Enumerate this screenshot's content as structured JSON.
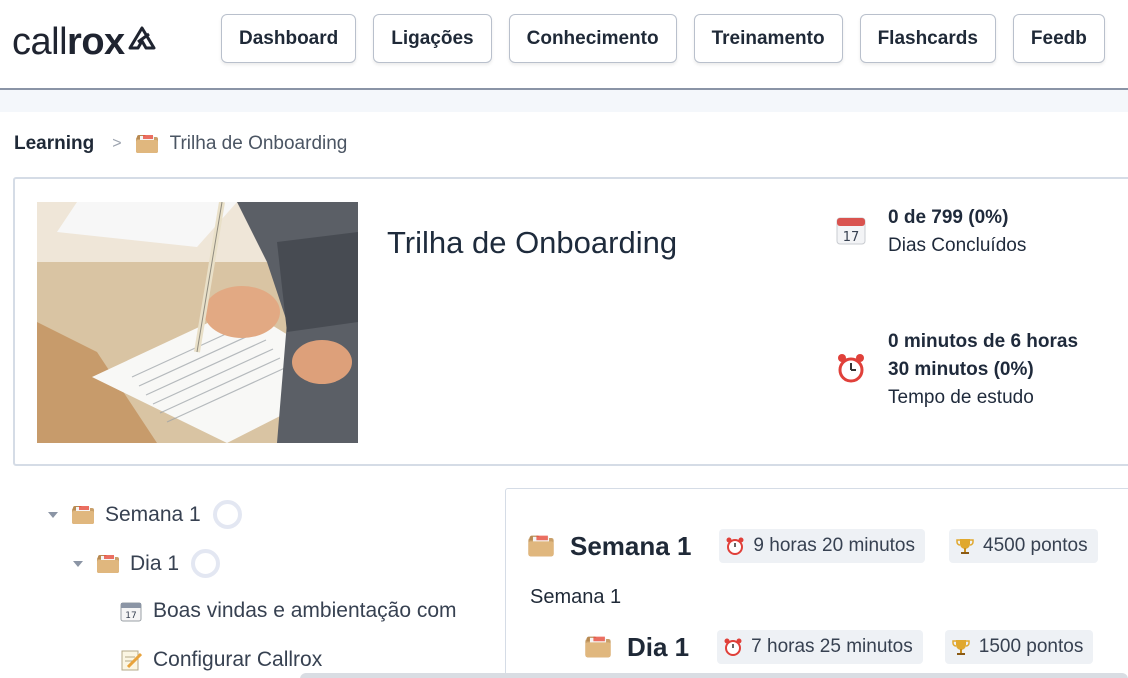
{
  "brand": {
    "name_thin": "call",
    "name_bold": "rox"
  },
  "nav": [
    "Dashboard",
    "Ligações",
    "Conhecimento",
    "Treinamento",
    "Flashcards",
    "Feedb"
  ],
  "breadcrumb": {
    "root": "Learning",
    "current": "Trilha de Onboarding"
  },
  "hero": {
    "title": "Trilha de Onboarding",
    "days": {
      "value": "0 de 799 (0%)",
      "label": "Dias Concluídos",
      "calendar_day": "17"
    },
    "study": {
      "value_line1": "0 minutos de 6 horas",
      "value_line2": "30 minutos (0%)",
      "label": "Tempo de estudo"
    }
  },
  "tree": {
    "week": "Semana 1",
    "day": "Dia 1",
    "items": [
      "Boas vindas e ambientação com",
      "Configurar Callrox"
    ]
  },
  "panel": {
    "week_title": "Semana 1",
    "week_time": "9 horas 20 minutos",
    "week_points": "4500 pontos",
    "description": "Semana 1",
    "day_title": "Dia 1",
    "day_time": "7 horas 25 minutos",
    "day_points": "1500 pontos"
  },
  "icons": {
    "logo": "arrow-mark-icon",
    "folder": "folder-icon",
    "calendar": "calendar-icon",
    "alarm": "alarm-clock-icon",
    "trophy": "trophy-icon",
    "memo": "memo-icon"
  },
  "colors": {
    "accent": "#1f2937",
    "pill_bg": "#eef1f5",
    "border": "#d5dce6"
  }
}
